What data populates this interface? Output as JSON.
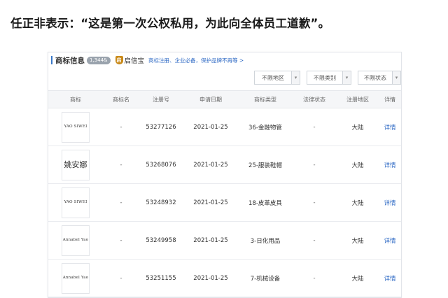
{
  "headline": "任正非表示：“这是第一次公权私用，为此向全体员工道歉”。",
  "panel": {
    "title": "商标信息",
    "count_badge": "1,344&",
    "brand_icon": "shield-icon",
    "brand": "启信宝",
    "promo": "商标注册、企业必备，保护品牌不再等 >"
  },
  "filters": [
    {
      "label": "不限地区"
    },
    {
      "label": "不限类别"
    },
    {
      "label": "不限状态"
    }
  ],
  "table": {
    "headers": [
      "商标",
      "商标名",
      "注册号",
      "申请日期",
      "商标类型",
      "法律状态",
      "注册地区",
      "详情"
    ],
    "rows": [
      {
        "logo": "YAO SIWEI",
        "name": "-",
        "reg_no": "53277126",
        "date": "2021-01-25",
        "type": "36-金融物管",
        "status": "-",
        "region": "大陆",
        "detail": "详情"
      },
      {
        "logo": "姚安娜",
        "name": "-",
        "reg_no": "53268076",
        "date": "2021-01-25",
        "type": "25-服装鞋帽",
        "status": "-",
        "region": "大陆",
        "detail": "详情"
      },
      {
        "logo": "YAO SIWEI",
        "name": "-",
        "reg_no": "53248932",
        "date": "2021-01-25",
        "type": "18-皮革皮具",
        "status": "-",
        "region": "大陆",
        "detail": "详情"
      },
      {
        "logo": "Annabel Yao",
        "name": "-",
        "reg_no": "53249958",
        "date": "2021-01-25",
        "type": "3-日化用品",
        "status": "-",
        "region": "大陆",
        "detail": "详情"
      },
      {
        "logo": "Annabel Yao",
        "name": "-",
        "reg_no": "53251155",
        "date": "2021-01-25",
        "type": "7-机械设备",
        "status": "-",
        "region": "大陆",
        "detail": "详情"
      }
    ]
  },
  "colors": {
    "accent": "#2c68c4",
    "brand_gold": "#c98a1a",
    "header_bg": "#f5f6f8"
  }
}
